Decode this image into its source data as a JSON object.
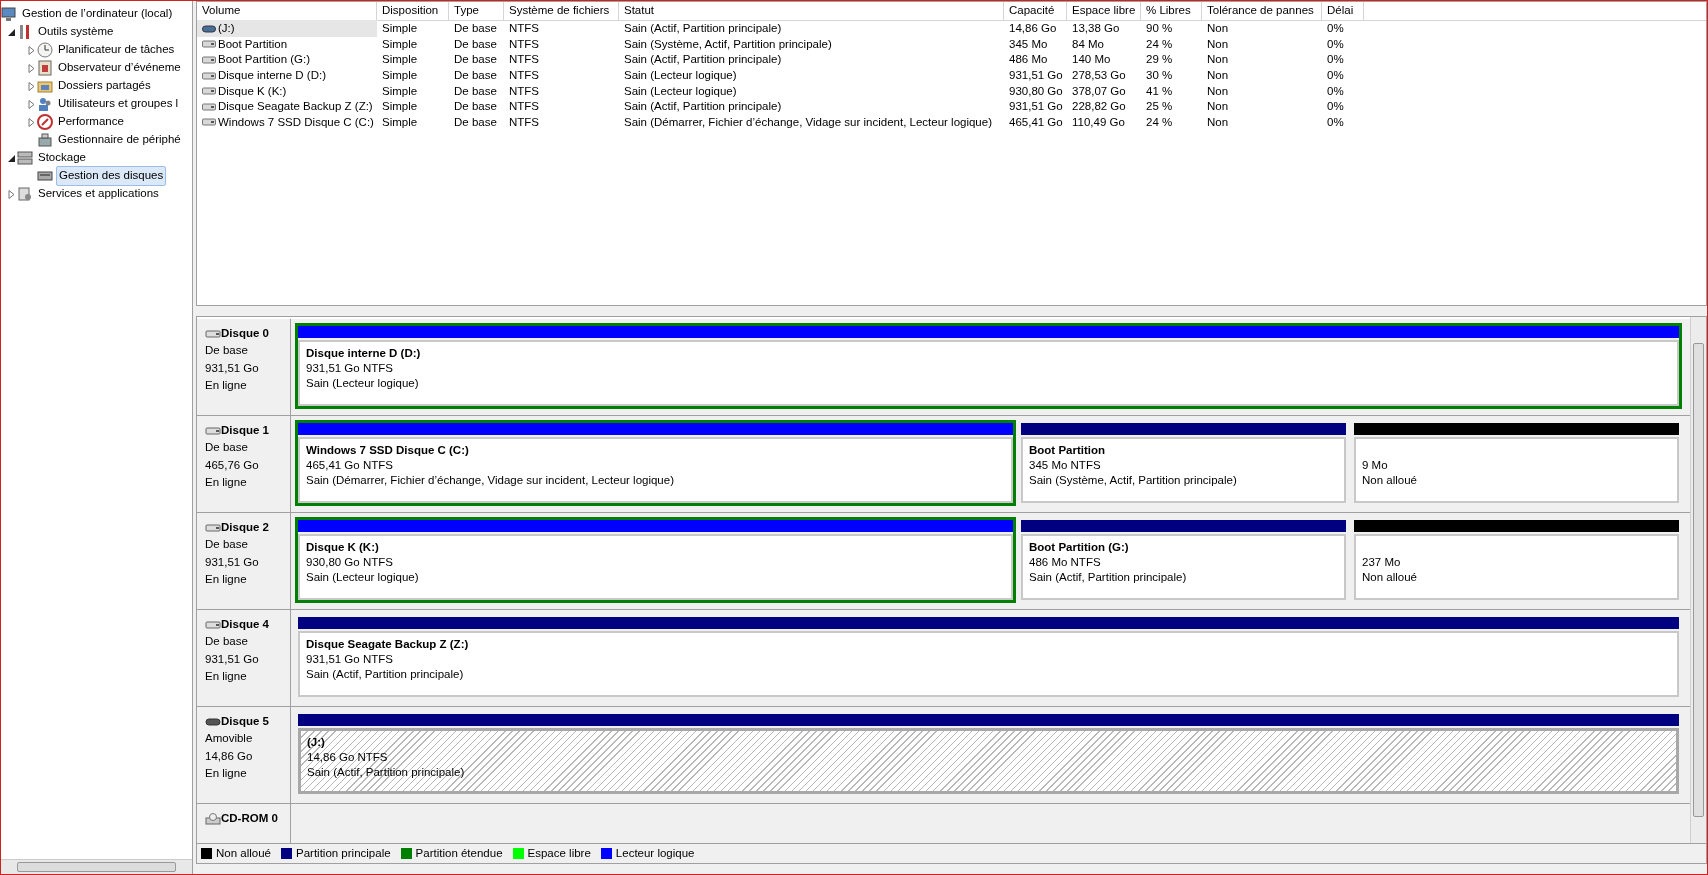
{
  "tree": [
    {
      "label": "Gestion de l’ordinateur (local)",
      "kind": "computer",
      "selected": false,
      "children": [
        {
          "label": "Outils système",
          "kind": "tools",
          "expanded": true,
          "selected": false,
          "children": [
            {
              "label": "Planificateur de tâches",
              "kind": "clock",
              "expanded": false,
              "selected": false
            },
            {
              "label": "Observateur d’événeme",
              "kind": "event",
              "expanded": false,
              "selected": false
            },
            {
              "label": "Dossiers partagés",
              "kind": "folder",
              "expanded": false,
              "selected": false
            },
            {
              "label": "Utilisateurs et groupes l",
              "kind": "users",
              "expanded": false,
              "selected": false
            },
            {
              "label": "Performance",
              "kind": "performance",
              "expanded": false,
              "selected": false
            },
            {
              "label": "Gestionnaire de périphé",
              "kind": "devices",
              "selected": false
            }
          ]
        },
        {
          "label": "Stockage",
          "kind": "storage",
          "expanded": true,
          "selected": false,
          "children": [
            {
              "label": "Gestion des disques",
              "kind": "diskmgmt",
              "selected": true
            }
          ]
        },
        {
          "label": "Services et applications",
          "kind": "services",
          "expanded": false,
          "selected": false
        }
      ]
    }
  ],
  "table": {
    "columns": [
      "Volume",
      "Disposition",
      "Type",
      "Système de fichiers",
      "Statut",
      "Capacité",
      "Espace libre",
      "% Libres",
      "Tolérance de pannes",
      "Délai"
    ],
    "rows": [
      {
        "kind": "removable",
        "selected": true,
        "cells": [
          "(J:)",
          "Simple",
          "De base",
          "NTFS",
          "Sain (Actif, Partition principale)",
          "14,86 Go",
          "13,38 Go",
          "90 %",
          "Non",
          "0%"
        ]
      },
      {
        "kind": "fixed",
        "selected": false,
        "cells": [
          "Boot Partition",
          "Simple",
          "De base",
          "NTFS",
          "Sain (Système, Actif, Partition principale)",
          "345 Mo",
          "84 Mo",
          "24 %",
          "Non",
          "0%"
        ]
      },
      {
        "kind": "fixed",
        "selected": false,
        "cells": [
          "Boot Partition (G:)",
          "Simple",
          "De base",
          "NTFS",
          "Sain (Actif, Partition principale)",
          "486 Mo",
          "140 Mo",
          "29 %",
          "Non",
          "0%"
        ]
      },
      {
        "kind": "fixed",
        "selected": false,
        "cells": [
          "Disque interne D (D:)",
          "Simple",
          "De base",
          "NTFS",
          "Sain (Lecteur logique)",
          "931,51 Go",
          "278,53 Go",
          "30 %",
          "Non",
          "0%"
        ]
      },
      {
        "kind": "fixed",
        "selected": false,
        "cells": [
          "Disque K (K:)",
          "Simple",
          "De base",
          "NTFS",
          "Sain (Lecteur logique)",
          "930,80 Go",
          "378,07 Go",
          "41 %",
          "Non",
          "0%"
        ]
      },
      {
        "kind": "fixed",
        "selected": false,
        "cells": [
          "Disque Seagate Backup Z (Z:)",
          "Simple",
          "De base",
          "NTFS",
          "Sain (Actif, Partition principale)",
          "931,51 Go",
          "228,82 Go",
          "25 %",
          "Non",
          "0%"
        ]
      },
      {
        "kind": "fixed",
        "selected": false,
        "cells": [
          "Windows 7  SSD Disque C (C:)",
          "Simple",
          "De base",
          "NTFS",
          "Sain (Démarrer, Fichier d’échange, Vidage sur incident, Lecteur logique)",
          "465,41 Go",
          "110,49 Go",
          "24 %",
          "Non",
          "0%"
        ]
      }
    ]
  },
  "disks": [
    {
      "name": "Disque 0",
      "kind": "fixed",
      "type": "De base",
      "size": "931,51 Go",
      "state": "En ligne",
      "partitions": [
        {
          "kind": "logical",
          "extended": true,
          "selected": false,
          "name": "Disque interne D  (D:)",
          "size": "931,51 Go NTFS",
          "status": "Sain (Lecteur logique)"
        }
      ]
    },
    {
      "name": "Disque 1",
      "kind": "fixed",
      "type": "De base",
      "size": "465,76 Go",
      "state": "En ligne",
      "partitions": [
        {
          "kind": "logical",
          "extended": true,
          "selected": false,
          "name": "Windows 7  SSD Disque C  (C:)",
          "size": "465,41 Go NTFS",
          "status": "Sain (Démarrer, Fichier d’échange, Vidage sur incident, Lecteur logique)"
        },
        {
          "kind": "primary",
          "extended": false,
          "selected": false,
          "name": "Boot Partition",
          "size": "345 Mo NTFS",
          "status": "Sain (Système, Actif, Partition principale)"
        },
        {
          "kind": "unallocated",
          "extended": false,
          "selected": false,
          "size": "9 Mo",
          "status": "Non alloué"
        }
      ]
    },
    {
      "name": "Disque 2",
      "kind": "fixed",
      "type": "De base",
      "size": "931,51 Go",
      "state": "En ligne",
      "partitions": [
        {
          "kind": "logical",
          "extended": true,
          "selected": false,
          "name": "Disque K  (K:)",
          "size": "930,80 Go NTFS",
          "status": "Sain (Lecteur logique)"
        },
        {
          "kind": "primary",
          "extended": false,
          "selected": false,
          "name": "Boot Partition  (G:)",
          "size": "486 Mo NTFS",
          "status": "Sain (Actif, Partition principale)"
        },
        {
          "kind": "unallocated",
          "extended": false,
          "selected": false,
          "size": "237 Mo",
          "status": "Non alloué"
        }
      ]
    },
    {
      "name": "Disque 4",
      "kind": "fixed",
      "type": "De base",
      "size": "931,51 Go",
      "state": "En ligne",
      "partitions": [
        {
          "kind": "primary",
          "extended": false,
          "selected": false,
          "name": "Disque Seagate Backup Z  (Z:)",
          "size": "931,51 Go NTFS",
          "status": "Sain (Actif, Partition principale)"
        }
      ]
    },
    {
      "name": "Disque 5",
      "kind": "removable",
      "type": "Amovible",
      "size": "14,86 Go",
      "state": "En ligne",
      "partitions": [
        {
          "kind": "primary",
          "extended": false,
          "selected": true,
          "name": "(J:)",
          "size": "14,86 Go NTFS",
          "status": "Sain (Actif, Partition principale)"
        }
      ]
    },
    {
      "name": "CD-ROM 0",
      "kind": "cdrom"
    }
  ],
  "legend": [
    {
      "label": "Non alloué",
      "color": "#000000"
    },
    {
      "label": "Partition principale",
      "color": "#000080"
    },
    {
      "label": "Partition étendue",
      "color": "#008000"
    },
    {
      "label": "Espace libre",
      "color": "#00ff00"
    },
    {
      "label": "Lecteur logique",
      "color": "#0000ff"
    }
  ]
}
